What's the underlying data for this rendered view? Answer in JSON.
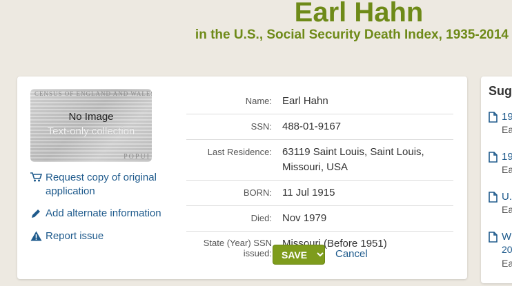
{
  "header": {
    "title": "Earl Hahn",
    "subtitle": "in the U.S., Social Security Death Index, 1935-2014"
  },
  "image": {
    "no_image": "No Image",
    "text_only": "Text-only collection",
    "watermark_top": "CENSUS OF ENGLAND AND WALES.",
    "watermark_bottom": "POPUI"
  },
  "actions": {
    "request_copy": "Request copy of original application",
    "add_alternate": "Add alternate information",
    "report_issue": "Report issue"
  },
  "facts": [
    {
      "label": "Name:",
      "value": "Earl Hahn"
    },
    {
      "label": "SSN:",
      "value": "488-01-9167"
    },
    {
      "label": "Last Residence:",
      "value": "63119 Saint Louis, Saint Louis, Missouri, USA"
    },
    {
      "label": "BORN:",
      "value": "11 Jul 1915"
    },
    {
      "label": "Died:",
      "value": "Nov 1979"
    },
    {
      "label": "State (Year) SSN issued:",
      "value": "Missouri (Before 1951)"
    }
  ],
  "buttons": {
    "save": "SAVE",
    "cancel": "Cancel"
  },
  "sidebar": {
    "heading": "Sugg",
    "items": [
      {
        "title": "19",
        "sub": "Ea"
      },
      {
        "title": "19",
        "sub": "Ea"
      },
      {
        "title": "U.",
        "sub": "Ea"
      },
      {
        "title": "W",
        "title2": "20",
        "sub": "Ea"
      }
    ]
  },
  "colors": {
    "accent_green": "#6e8a18",
    "button_green": "#7e9c1c",
    "link_blue": "#1e5a8c",
    "page_bg": "#ede9e1"
  }
}
